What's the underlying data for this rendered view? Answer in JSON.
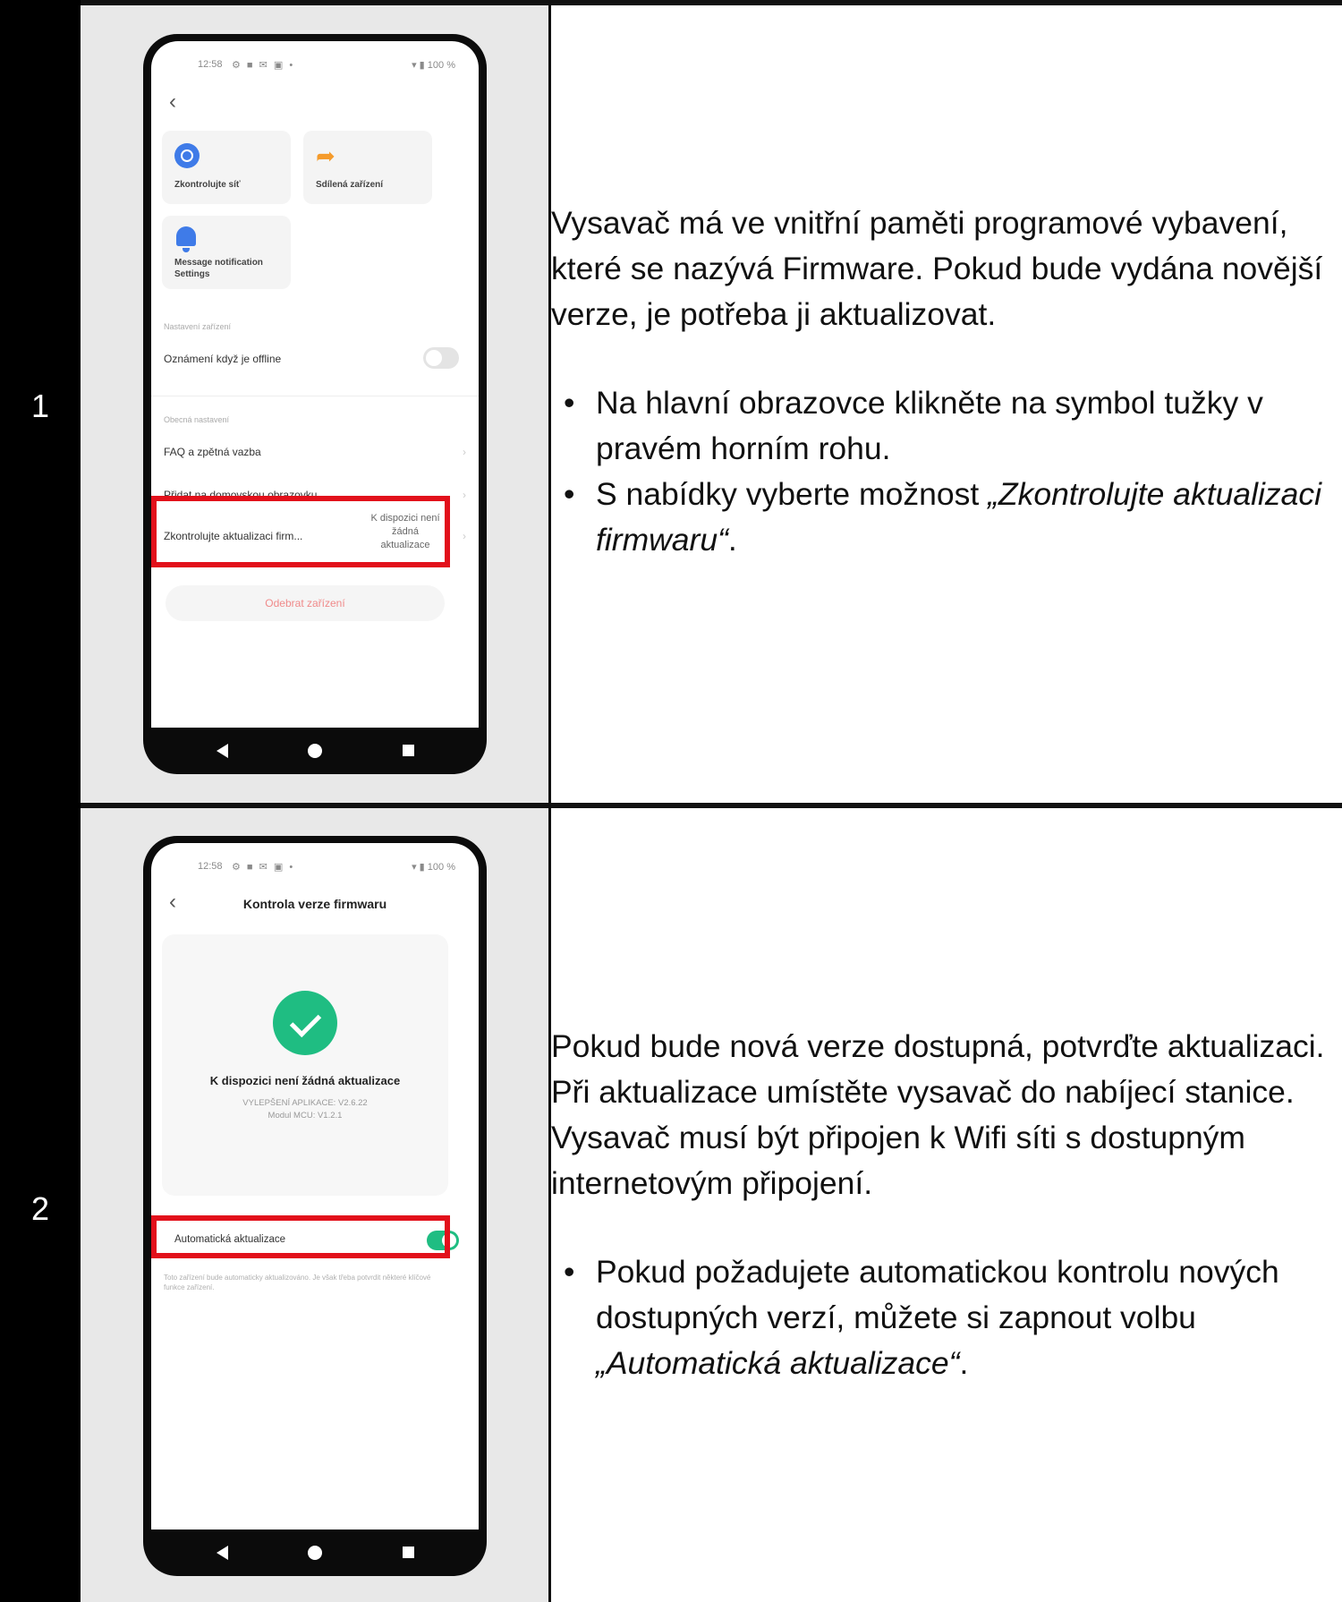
{
  "steps": [
    {
      "number": "1",
      "paragraph": "Vysavač má ve vnitřní paměti programové vybavení, které se nazývá Firmware. Pokud bude vydána novější verze, je potřeba ji aktualizovat.",
      "bullet1": "Na hlavní obrazovce klikněte na symbol tužky v pravém horním rohu.",
      "bullet2_prefix": "S nabídky vyberte možnost ",
      "bullet2_italic": "„Zkontrolujte aktualizaci firmwaru“",
      "bullet2_suffix": ".",
      "phone": {
        "time": "12:58",
        "status_icons": "⚙ ■ ✉ ▣ •",
        "battery": "▾ ▮ 100 %",
        "back": "‹",
        "tile_check_network": "Zkontrolujte síť",
        "tile_share": "Sdílená zařízení",
        "tile_notification": "Message notification Settings",
        "section_device": "Nastavení zařízení",
        "offline_notice": "Oznámení když je offline",
        "section_general": "Obecná nastavení",
        "faq": "FAQ a zpětná vazba",
        "add_home": "Přidat na domovskou obrazovku",
        "check_fw": "Zkontrolujte aktualizaci firm...",
        "no_update": "K dispozici není žádná aktualizace",
        "chevron": "›",
        "remove_device": "Odebrat zařízení"
      }
    },
    {
      "number": "2",
      "paragraph": "Pokud bude nová verze dostupná, potvrďte aktualizaci. Při aktualizace umístěte vysavač do nabíjecí stanice. Vysavač musí být připojen k Wifi síti s dostupným internetovým připojení.",
      "bullet1_prefix": "Pokud požadujete automatickou kontrolu nových dostupných verzí, můžete si zapnout volbu ",
      "bullet1_italic": "„Automatická aktualizace“",
      "bullet1_suffix": ".",
      "phone": {
        "time": "12:58",
        "status_icons": "⚙ ■ ✉ ▣ •",
        "battery": "▾ ▮ 100 %",
        "back": "‹",
        "title": "Kontrola verze firmwaru",
        "no_update": "K dispozici není žádná aktualizace",
        "app_version": "VYLEPŠENÍ APLIKACE: V2.6.22",
        "mcu_version": "Modul MCU: V1.2.1",
        "auto_update": "Automatická aktualizace",
        "auto_note": "Toto zařízení bude automaticky aktualizováno. Je však třeba potvrdit některé klíčové funkce zařízení."
      }
    }
  ],
  "colors": {
    "highlight": "#e2101b",
    "toggle_on": "#1fbd82",
    "step_column": "#000000",
    "image_cell": "#e8e8e8"
  }
}
